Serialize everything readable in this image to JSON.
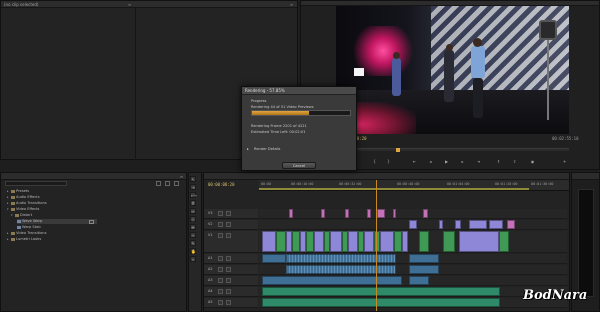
{
  "source_panel": {
    "tab": "(no clip selected)"
  },
  "program": {
    "timecode_left": "00:00:08:20",
    "timecode_right": "00:02:55:10",
    "transport_buttons": [
      "mark-in",
      "mark-out",
      "go-to-in",
      "step-back",
      "play",
      "step-forward",
      "go-to-out",
      "lift",
      "extract",
      "export-frame",
      "add"
    ]
  },
  "render_dialog": {
    "title": "Rendering - 57.85%",
    "progress_label": "Progress",
    "status_line": "Rendering 44 of 51 Video Previews",
    "progress": 0.58,
    "frames_line": "Rendering Frame 2201 of 4221",
    "estimated_line": "Estimated Time Left: 00:02:01",
    "details_label": "Render Details",
    "cancel_label": "Cancel"
  },
  "effects_panel": {
    "search_placeholder": "",
    "items": [
      {
        "label": "Presets",
        "level": 0,
        "expanded": false
      },
      {
        "label": "Audio Effects",
        "level": 0,
        "expanded": false
      },
      {
        "label": "Audio Transitions",
        "level": 0,
        "expanded": false
      },
      {
        "label": "Video Effects",
        "level": 0,
        "expanded": true
      },
      {
        "label": "Distort",
        "level": 1,
        "expanded": true
      },
      {
        "label": "Wave Warp",
        "level": 2,
        "expanded": false
      },
      {
        "label": "Warp Stab",
        "level": 2,
        "expanded": false
      },
      {
        "label": "Video Transitions",
        "level": 0,
        "expanded": false
      },
      {
        "label": "Lumetri Looks",
        "level": 0,
        "expanded": false
      }
    ]
  },
  "timeline": {
    "timecode": "00:00:08:20",
    "ruler_ticks": [
      "00:00",
      "00:00:16:00",
      "00:00:32:00",
      "00:00:48:00",
      "00:01:04:00",
      "00:01:20:00",
      "00:01:36:00"
    ],
    "track_labels": [
      "V3",
      "V2",
      "V1",
      "A1",
      "A2",
      "A3",
      "A4",
      "A5"
    ],
    "playhead_fraction": 0.38
  },
  "watermark": "BodNara",
  "colors": {
    "accent": "#e0a640",
    "clip_purple": "#8e86d6",
    "clip_green": "#3e9a54",
    "clip_blue": "#3f6f95",
    "clip_teal": "#2f8a6a"
  }
}
